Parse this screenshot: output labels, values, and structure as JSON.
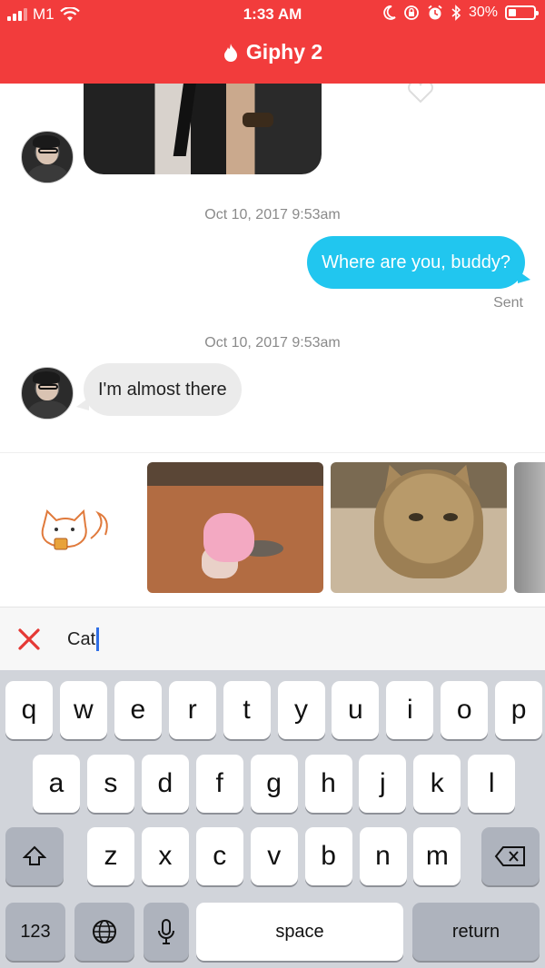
{
  "status_bar": {
    "carrier": "M1",
    "time": "1:33 AM",
    "battery_percent": "30%",
    "battery_level": 0.3,
    "icons": [
      "signal-icon",
      "wifi-icon",
      "moon-icon",
      "lock-rotation-icon",
      "alarm-icon",
      "bluetooth-icon",
      "battery-icon"
    ]
  },
  "header": {
    "title": "Giphy 2",
    "icon": "flame-icon",
    "accent_color": "#f23c3c"
  },
  "chat": {
    "messages": [
      {
        "type": "timestamp",
        "text": "Oct 10, 2017 9:53am"
      },
      {
        "type": "outgoing",
        "text": "Where are you, buddy?",
        "status": "Sent",
        "color": "#21c6ef"
      },
      {
        "type": "timestamp",
        "text": "Oct 10, 2017 9:53am"
      },
      {
        "type": "incoming",
        "text": "I'm almost there"
      }
    ]
  },
  "gif_picker": {
    "results": [
      "cat-drawing-gif",
      "baby-and-cat-gif",
      "kitten-gif",
      "partial-gif"
    ]
  },
  "search": {
    "value": "Cat",
    "clear_icon": "close-icon"
  },
  "keyboard": {
    "row1": [
      "q",
      "w",
      "e",
      "r",
      "t",
      "y",
      "u",
      "i",
      "o",
      "p"
    ],
    "row2": [
      "a",
      "s",
      "d",
      "f",
      "g",
      "h",
      "j",
      "k",
      "l"
    ],
    "row3": [
      "z",
      "x",
      "c",
      "v",
      "b",
      "n",
      "m"
    ],
    "numbers_label": "123",
    "space_label": "space",
    "return_label": "return"
  }
}
